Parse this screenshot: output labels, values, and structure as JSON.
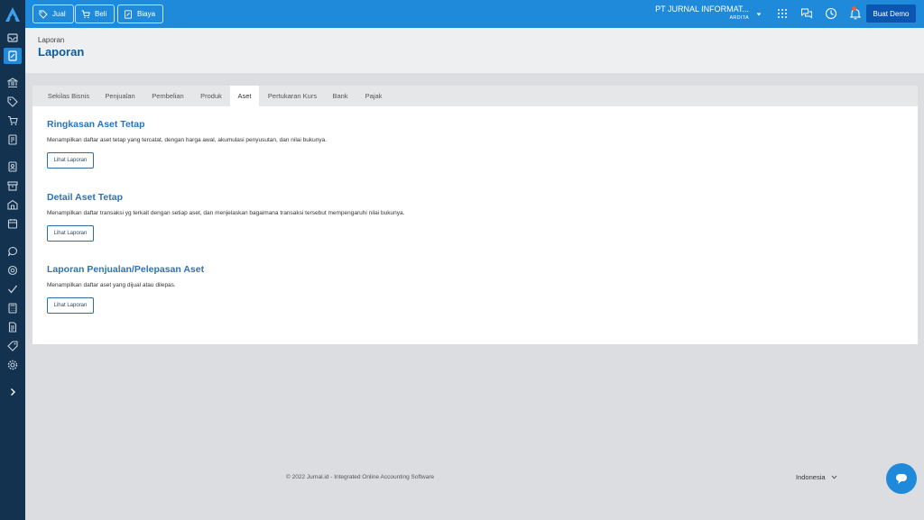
{
  "app": {
    "logo_icon": "jurnal-logo-icon",
    "accent": "#1f8ad9",
    "sidebar_bg": "#13324f"
  },
  "topbar": {
    "buttons": [
      {
        "label": "Jual",
        "icon": "tag-icon"
      },
      {
        "label": "Beli",
        "icon": "cart-icon"
      },
      {
        "label": "Biaya",
        "icon": "expense-icon"
      }
    ],
    "company_name": "PT JURNAL INFORMAT...",
    "user_name": "ARDITA",
    "demo_label": "Buat Demo"
  },
  "header": {
    "breadcrumb": "Laporan",
    "title": "Laporan"
  },
  "tabs": [
    {
      "label": "Sekilas Bisnis"
    },
    {
      "label": "Penjualan"
    },
    {
      "label": "Pembelian"
    },
    {
      "label": "Produk"
    },
    {
      "label": "Aset",
      "active": true
    },
    {
      "label": "Pertukaran Kurs"
    },
    {
      "label": "Bank"
    },
    {
      "label": "Pajak"
    }
  ],
  "sections": [
    {
      "title": "Ringkasan Aset Tetap",
      "description": "Menampilkan daftar aset tetap yang tercatat, dengan harga awal, akumulasi penyusutan, dan nilai bukunya.",
      "button_label": "Lihat Laporan"
    },
    {
      "title": "Detail Aset Tetap",
      "description": "Menampilkan daftar transaksi yg terkait dengan setiap aset, dan menjelaskan bagaimana transaksi tersebut mempengaruhi nilai bukunya.",
      "button_label": "Lihat Laporan"
    },
    {
      "title": "Laporan Penjualan/Pelepasan Aset",
      "description": "Menampilkan daftar aset yang dijual atau dilepas.",
      "button_label": "Lihat Laporan"
    }
  ],
  "footer": {
    "copyright": "© 2022 Jurnal.id - Integrated Online Accounting Software",
    "language": "Indonesia"
  }
}
